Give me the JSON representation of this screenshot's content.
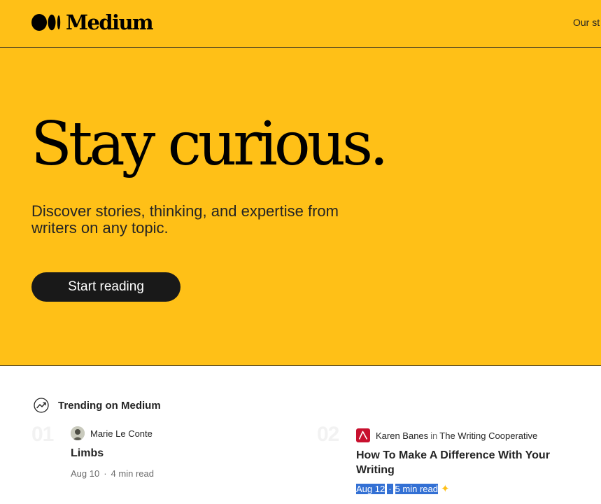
{
  "nav": {
    "logo_text": "Medium",
    "link_partial": "Our st"
  },
  "hero": {
    "title": "Stay curious.",
    "subtitle": "Discover stories, thinking, and expertise from writers on any topic.",
    "button_label": "Start reading"
  },
  "trending": {
    "heading": "Trending on Medium",
    "items": [
      {
        "number": "01",
        "author": "Marie Le Conte",
        "title": "Limbs",
        "date": "Aug 10",
        "read_time": "4 min read"
      },
      {
        "number": "02",
        "author": "Karen Banes",
        "in_word": "in",
        "publication": "The Writing Cooperative",
        "title": "How To Make A Difference With Your Writing",
        "date": "Aug 12",
        "read_time": "5 min read"
      }
    ]
  },
  "colors": {
    "brand_yellow": "#ffc017",
    "button_dark": "#191919",
    "selection_blue": "#3370d4",
    "publication_red": "#c8102e"
  }
}
